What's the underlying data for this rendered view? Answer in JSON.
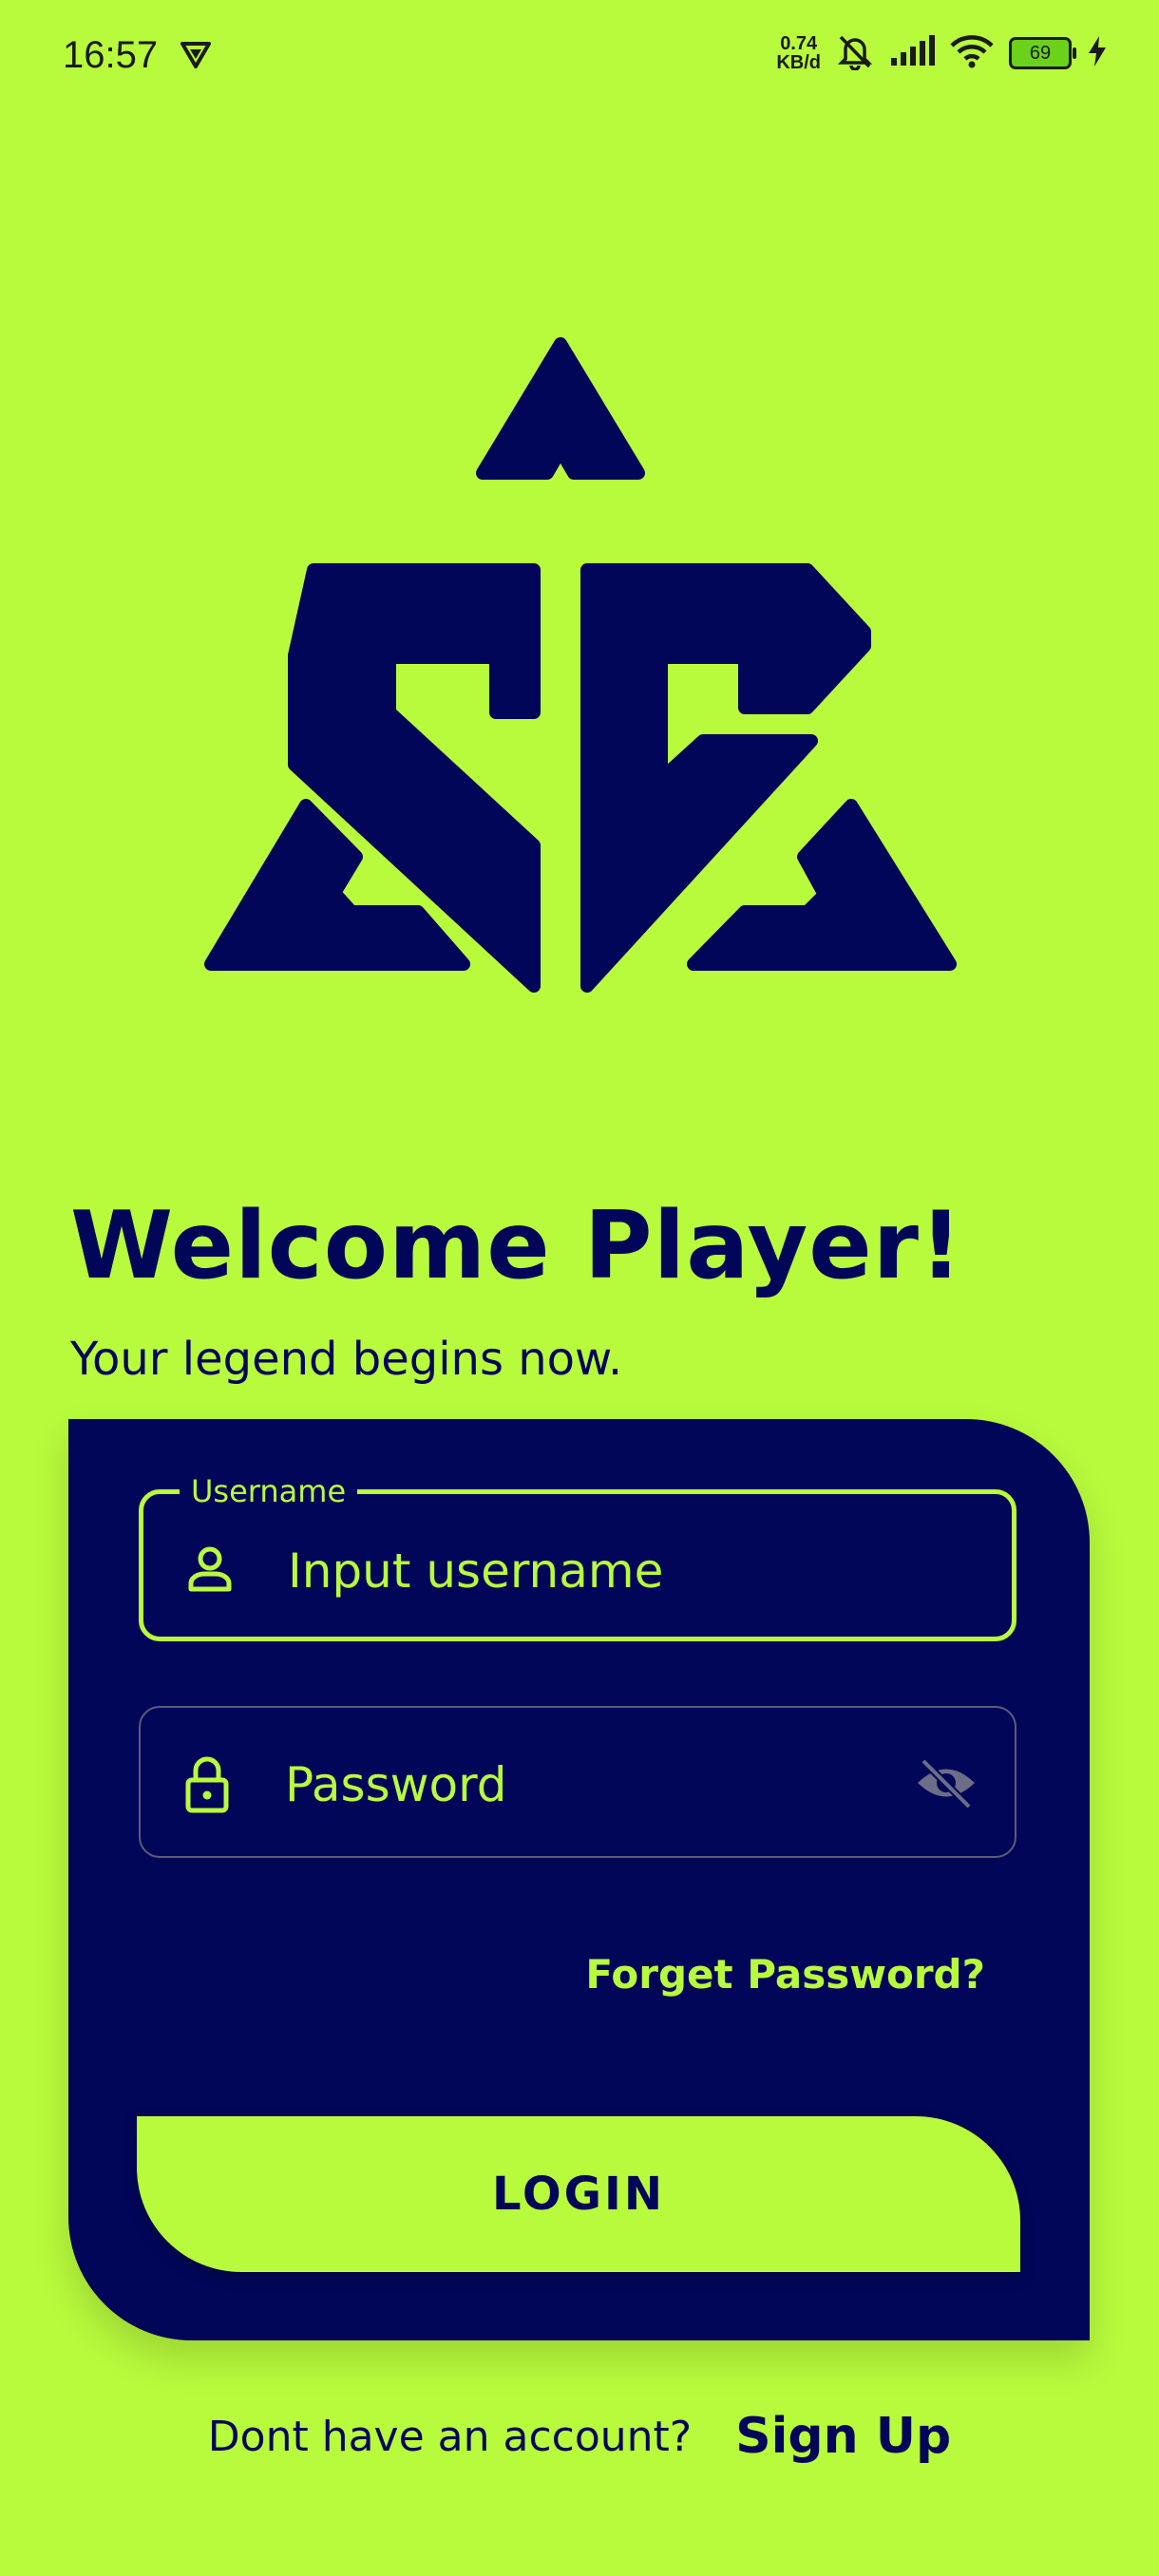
{
  "status_bar": {
    "time": "16:57",
    "net_speed_value": "0.74",
    "net_speed_unit": "KB/d",
    "battery": "69",
    "icons": [
      "vpn-icon",
      "mute-bell-icon",
      "signal-icon",
      "wifi-icon",
      "battery-icon",
      "charging-icon"
    ]
  },
  "colors": {
    "background": "#b8fb3c",
    "card": "#020659",
    "accent": "#b8fb3c"
  },
  "header": {
    "title": "Welcome Player!",
    "subtitle": "Your legend begins now."
  },
  "form": {
    "username_label": "Username",
    "username_placeholder": "Input username",
    "password_placeholder": "Password",
    "forget_password": "Forget Password?",
    "login_label": "LOGIN"
  },
  "footer": {
    "prompt": "Dont have an account?",
    "signup_label": "Sign Up"
  }
}
